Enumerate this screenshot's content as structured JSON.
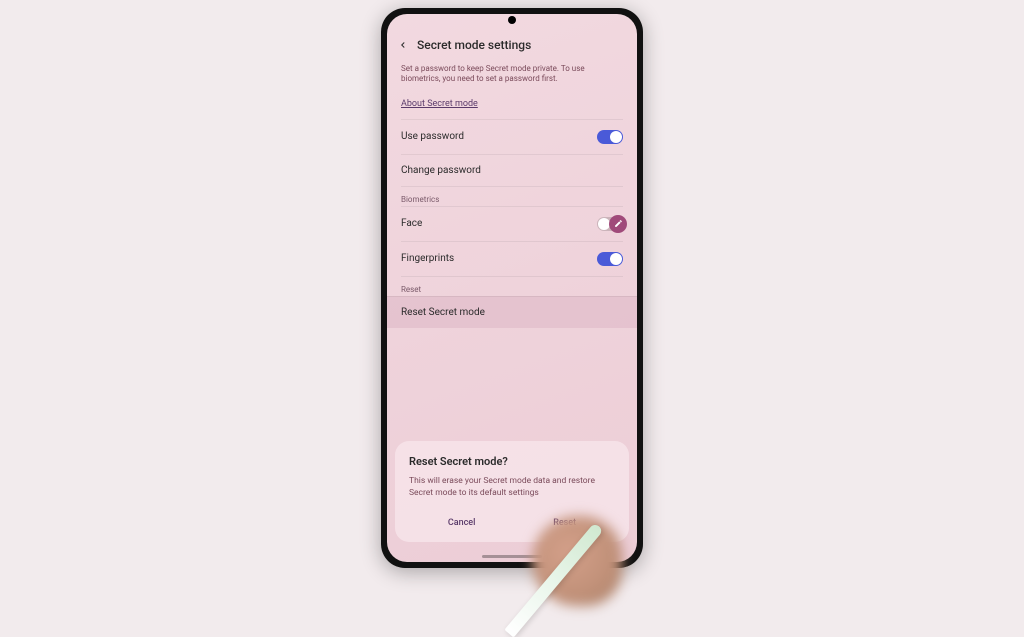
{
  "header": {
    "title": "Secret mode settings"
  },
  "description": "Set a password to keep Secret mode private. To use biometrics, you need to set a password first.",
  "about_link": "About Secret mode",
  "rows": {
    "use_password": "Use password",
    "change_password": "Change password",
    "face": "Face",
    "fingerprints": "Fingerprints",
    "reset_secret": "Reset Secret mode"
  },
  "sections": {
    "biometrics": "Biometrics",
    "reset": "Reset"
  },
  "toggles": {
    "use_password": true,
    "face": false,
    "fingerprints": true
  },
  "dialog": {
    "title": "Reset Secret mode?",
    "body": "This will erase your Secret mode data and restore Secret mode to its default settings",
    "cancel": "Cancel",
    "confirm": "Reset"
  }
}
